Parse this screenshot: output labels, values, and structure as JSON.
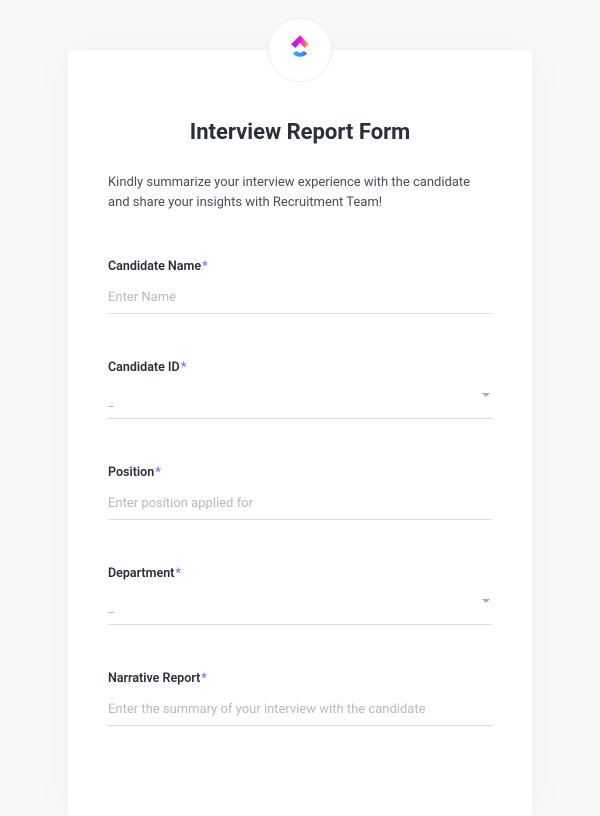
{
  "form": {
    "title": "Interview Report Form",
    "intro": "Kindly summarize your interview experience with the candidate and share your insights with Recruitment Team!",
    "fields": {
      "candidate_name": {
        "label": "Candidate Name",
        "required": "*",
        "placeholder": "Enter Name"
      },
      "candidate_id": {
        "label": "Candidate ID",
        "required": "*",
        "placeholder": "_"
      },
      "position": {
        "label": "Position",
        "required": "*",
        "placeholder": "Enter position applied for"
      },
      "department": {
        "label": "Department",
        "required": "*",
        "placeholder": "_"
      },
      "narrative_report": {
        "label": "Narrative Report",
        "required": "*",
        "placeholder": "Enter the summary of your interview with the candidate"
      }
    }
  }
}
